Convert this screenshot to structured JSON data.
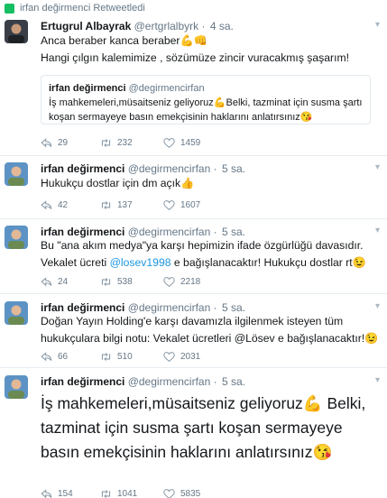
{
  "retweet_banner": {
    "text": "irfan değirmenci Retweetledi"
  },
  "tweets": [
    {
      "name": "Ertugrul Albayrak",
      "handle": "@ertgrlalbyrk",
      "time": "4 sa.",
      "lines": [
        "Anca beraber kanca beraber💪👊",
        "Hangi çılgın kalemimize , sözümüze zincir vuracakmış şaşarım!"
      ],
      "quote": {
        "name": "irfan değirmenci",
        "handle": "@degirmencirfan",
        "text": "İş mahkemeleri,müsaitseniz geliyoruz💪Belki, tazminat için susma şartı koşan sermayeye basın emekçisinin haklarını anlatırsınız😘"
      },
      "replies": "29",
      "retweets": "232",
      "likes": "1459"
    },
    {
      "name": "irfan değirmenci",
      "handle": "@degirmencirfan",
      "time": "5 sa.",
      "text": "Hukukçu dostlar için dm açık👍",
      "replies": "42",
      "retweets": "137",
      "likes": "1607"
    },
    {
      "name": "irfan değirmenci",
      "handle": "@degirmencirfan",
      "time": "5 sa.",
      "text_pre": "Bu \"ana akım medya\"ya karşı hepimizin ifade özgürlüğü davasıdır. Vekalet ücreti ",
      "mention": "@losev1998",
      "text_post": " e bağışlanacaktır! Hukukçu dostlar rt😉",
      "replies": "24",
      "retweets": "538",
      "likes": "2218"
    },
    {
      "name": "irfan değirmenci",
      "handle": "@degirmencirfan",
      "time": "5 sa.",
      "text": "Doğan Yayın Holding'e karşı davamızla ilgilenmek isteyen tüm hukukçulara bilgi notu: Vekalet ücretleri @Lösev e bağışlanacaktır!😉",
      "replies": "66",
      "retweets": "510",
      "likes": "2031"
    },
    {
      "name": "irfan değirmenci",
      "handle": "@degirmencirfan",
      "time": "5 sa.",
      "text": "İş mahkemeleri,müsaitseniz geliyoruz💪 Belki, tazminat için susma şartı koşan sermayeye basın emekçisinin haklarını anlatırsınız😘",
      "replies": "154",
      "retweets": "1041",
      "likes": "5835"
    }
  ],
  "icons": {
    "reply": "reply-icon",
    "retweet": "retweet-icon",
    "like": "heart-icon",
    "menu": "chevron-down-icon"
  },
  "colors": {
    "link": "#1b95e0",
    "muted": "#657786",
    "retweet": "#17bf63"
  }
}
